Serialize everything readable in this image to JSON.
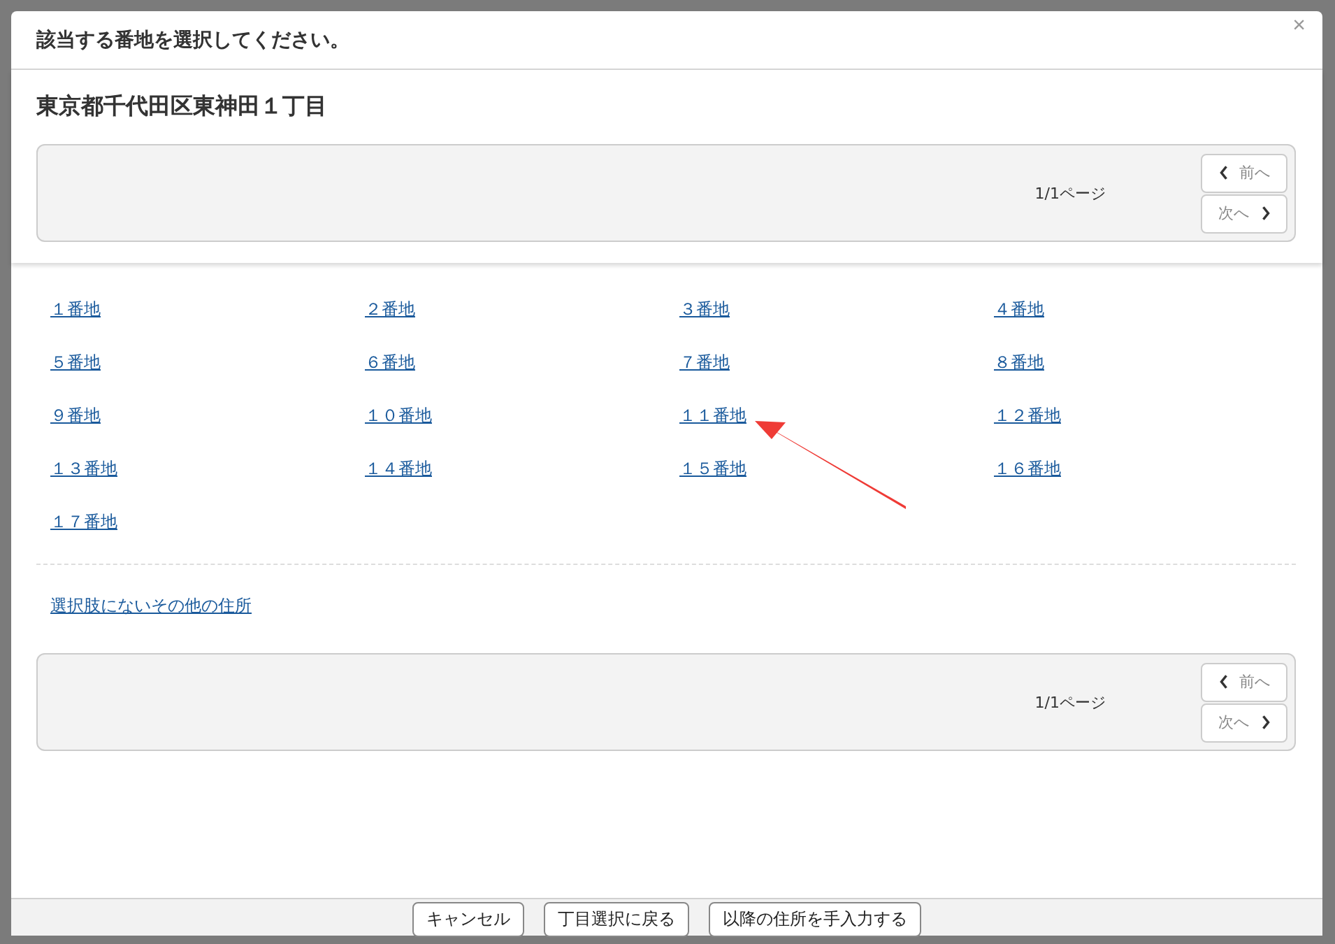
{
  "dialog": {
    "title": "該当する番地を選択してください。",
    "close": "×"
  },
  "heading": "東京都千代田区東神田１丁目",
  "pager_top": {
    "page": "1/1ページ",
    "prev": "前へ",
    "next": "次へ"
  },
  "addresses": [
    "１番地",
    "２番地",
    "３番地",
    "４番地",
    "５番地",
    "６番地",
    "７番地",
    "８番地",
    "９番地",
    "１０番地",
    "１１番地",
    "１２番地",
    "１３番地",
    "１４番地",
    "１５番地",
    "１６番地",
    "１７番地"
  ],
  "other_link": "選択肢にないその他の住所",
  "pager_bottom": {
    "page": "1/1ページ",
    "prev": "前へ",
    "next": "次へ"
  },
  "buttons": [
    "キャンセル",
    "丁目選択に戻る",
    "以降の住所を手入力する"
  ]
}
